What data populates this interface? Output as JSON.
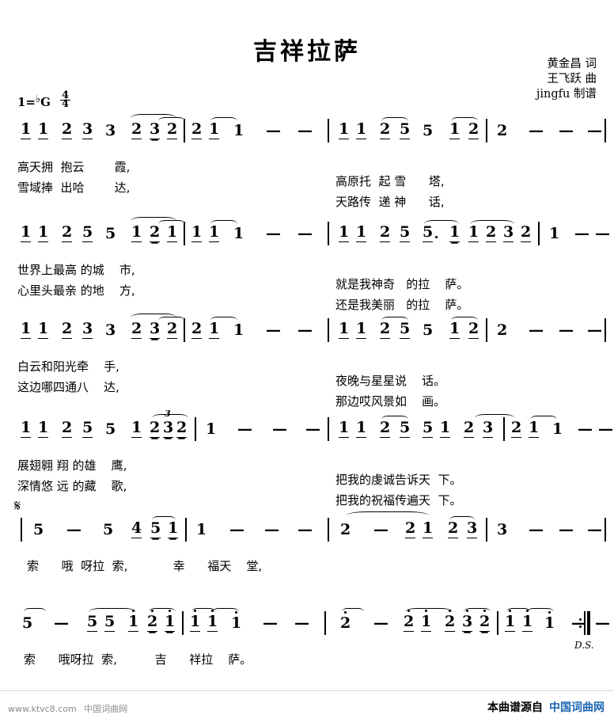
{
  "header": {
    "title": "吉祥拉萨",
    "lyricist": "黄金昌 词",
    "composer": "王飞跃 曲",
    "engraver": "jingfu 制谱",
    "key_prefix": "1=",
    "key_accidental": "♭",
    "key_note": "G",
    "time_numerator": "4",
    "time_denominator": "4"
  },
  "systems": [
    {
      "id": "system-1",
      "notes": [
        "1",
        "1",
        "2",
        "3",
        "3",
        "2",
        "3",
        "2",
        "2",
        "1",
        "1",
        "—",
        "—",
        "1",
        "1",
        "2",
        "5",
        "5",
        "1",
        "2",
        "2",
        "—",
        "—",
        "—"
      ],
      "lyrics_line1": "高天拥  抱云        霞,",
      "lyrics_line2": "雪域捧  出哈        达,",
      "lyrics_line1_b": "高原托  起 雪      塔,",
      "lyrics_line2_b": "天路传  递 神      话,"
    },
    {
      "id": "system-2",
      "notes": [
        "1",
        "1",
        "2",
        "5",
        "5",
        "1",
        "2",
        "1",
        "1",
        "1",
        "1",
        "—",
        "—",
        "1",
        "1",
        "2",
        "5",
        "5.",
        "1",
        "1",
        "2",
        "3",
        "2",
        "1",
        "—",
        "—",
        "—"
      ],
      "lyrics_line1": "世界上最高 的城    市,",
      "lyrics_line2": "心里头最亲 的地    方,",
      "lyrics_line1_b": "就是我神奇   的拉    萨。",
      "lyrics_line2_b": "还是我美丽   的拉    萨。"
    },
    {
      "id": "system-3",
      "notes": [
        "1",
        "1",
        "2",
        "3",
        "3",
        "2",
        "3",
        "2",
        "2",
        "1",
        "1",
        "—",
        "—",
        "1",
        "1",
        "2",
        "5",
        "5",
        "1",
        "2",
        "2",
        "—",
        "—",
        "—"
      ],
      "lyrics_line1": "白云和阳光牵    手,",
      "lyrics_line2": "这边哪四通八    达,",
      "lyrics_line1_b": "夜晚与星星说    话。",
      "lyrics_line2_b": "那边哎风景如    画。"
    },
    {
      "id": "system-4",
      "notes": [
        "1",
        "1",
        "2",
        "5",
        "5",
        "1",
        "2",
        "3",
        "2",
        "1",
        "—",
        "—",
        "—",
        "1",
        "1",
        "2",
        "5",
        "5",
        "1",
        "2",
        "3",
        "2",
        "1",
        "1",
        "—",
        "—"
      ],
      "triplet": "3",
      "lyrics_line1": "展翅翱 翔 的雄    鹰,",
      "lyrics_line2": "深情悠 远 的藏    歌,",
      "lyrics_line1_b": "把我的虔诚告诉天  下。",
      "lyrics_line2_b": "把我的祝福传遍天  下。"
    },
    {
      "id": "system-5",
      "notes": [
        "5",
        "—",
        "5",
        "4",
        "5",
        "1",
        "1",
        "—",
        "—",
        "—",
        "2",
        "—",
        "2",
        "1",
        "2",
        "3",
        "3",
        "—",
        "—",
        "—"
      ],
      "segno": "𝄋",
      "lyrics_line1": "索      哦  呀拉  索,            幸      福天    堂,"
    },
    {
      "id": "system-6",
      "notes": [
        "5",
        "—",
        "5",
        "5",
        "1",
        "2",
        "1",
        "1",
        "1",
        "1",
        "—",
        "—",
        "2",
        "—",
        "2",
        "1",
        "2",
        "3",
        "2",
        "1",
        "1",
        "1",
        "—",
        "—"
      ],
      "ds_mark": "D.S.",
      "lyrics_line1": "索      哦呀拉  索,          吉      祥拉    萨。"
    }
  ],
  "footer": {
    "site_url": "www.ktvc8.com",
    "site_name": "中国词曲网",
    "source_label": "本曲谱源自",
    "source_site": "中国词曲网",
    "link_color": "#1b63b0"
  }
}
